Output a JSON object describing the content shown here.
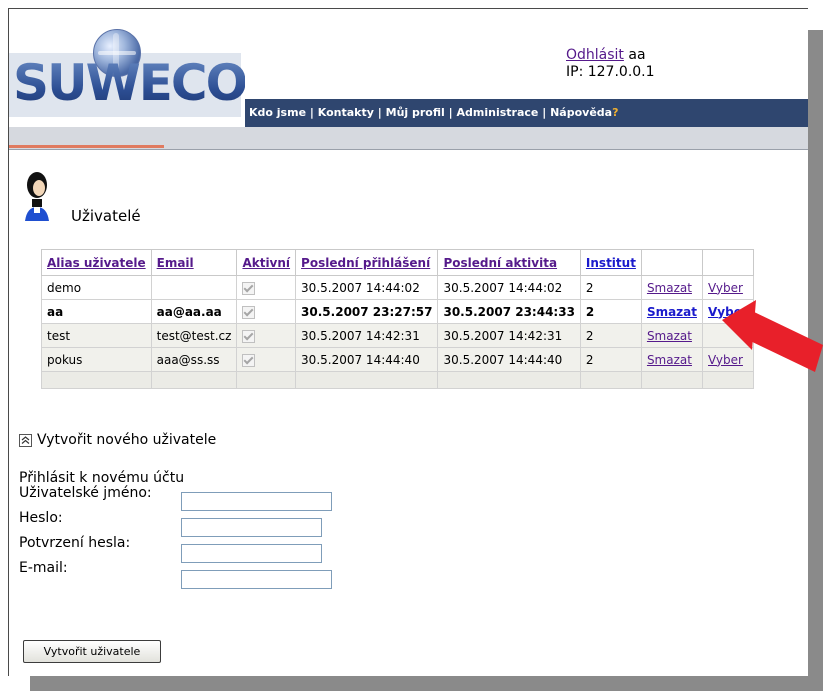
{
  "header": {
    "logo_text": "SUWECO",
    "logout_link": "Odhlásit",
    "username": "aa",
    "ip_label": "IP: 127.0.0.1"
  },
  "nav": {
    "items": [
      "Kdo jsme",
      "Kontakty",
      "Můj profil",
      "Administrace",
      "Nápověda"
    ],
    "separator": "|",
    "help_suffix": "?"
  },
  "page": {
    "title": "Uživatelé"
  },
  "table": {
    "headers": [
      "Alias uživatele",
      "Email",
      "Aktivní",
      "Poslední přihlášení",
      "Poslední aktivita",
      "Institut",
      "",
      ""
    ],
    "rows": [
      {
        "alias": "demo",
        "email": "",
        "active": true,
        "last_login": "30.5.2007 14:44:02",
        "last_activity": "30.5.2007 14:44:02",
        "institut": "2",
        "delete": "Smazat",
        "select": "Vyber"
      },
      {
        "alias": "aa",
        "email": "aa@aa.aa",
        "active": true,
        "last_login": "30.5.2007 23:27:57",
        "last_activity": "30.5.2007 23:44:33",
        "institut": "2",
        "delete": "Smazat",
        "select": "Vyber"
      },
      {
        "alias": "test",
        "email": "test@test.cz",
        "active": true,
        "last_login": "30.5.2007 14:42:31",
        "last_activity": "30.5.2007 14:42:31",
        "institut": "2",
        "delete": "Smazat",
        "select": ""
      },
      {
        "alias": "pokus",
        "email": "aaa@ss.ss",
        "active": true,
        "last_login": "30.5.2007 14:44:40",
        "last_activity": "30.5.2007 14:44:40",
        "institut": "2",
        "delete": "Smazat",
        "select": "Vyber"
      }
    ]
  },
  "create": {
    "toggle_label": "Vytvořit nového uživatele",
    "form_heading": "Přihlásit k novému účtu",
    "username_label": "Uživatelské jméno:",
    "password_label": "Heslo:",
    "password_confirm_label": "Potvrzení hesla:",
    "email_label": "E-mail:",
    "username_value": "",
    "password_value": "",
    "password_confirm_value": "",
    "email_value": "",
    "submit_label": "Vytvořit uživatele"
  },
  "colors": {
    "navbar": "#2f466f",
    "accent_arrow": "#e8202a",
    "logo": "#24437e"
  }
}
